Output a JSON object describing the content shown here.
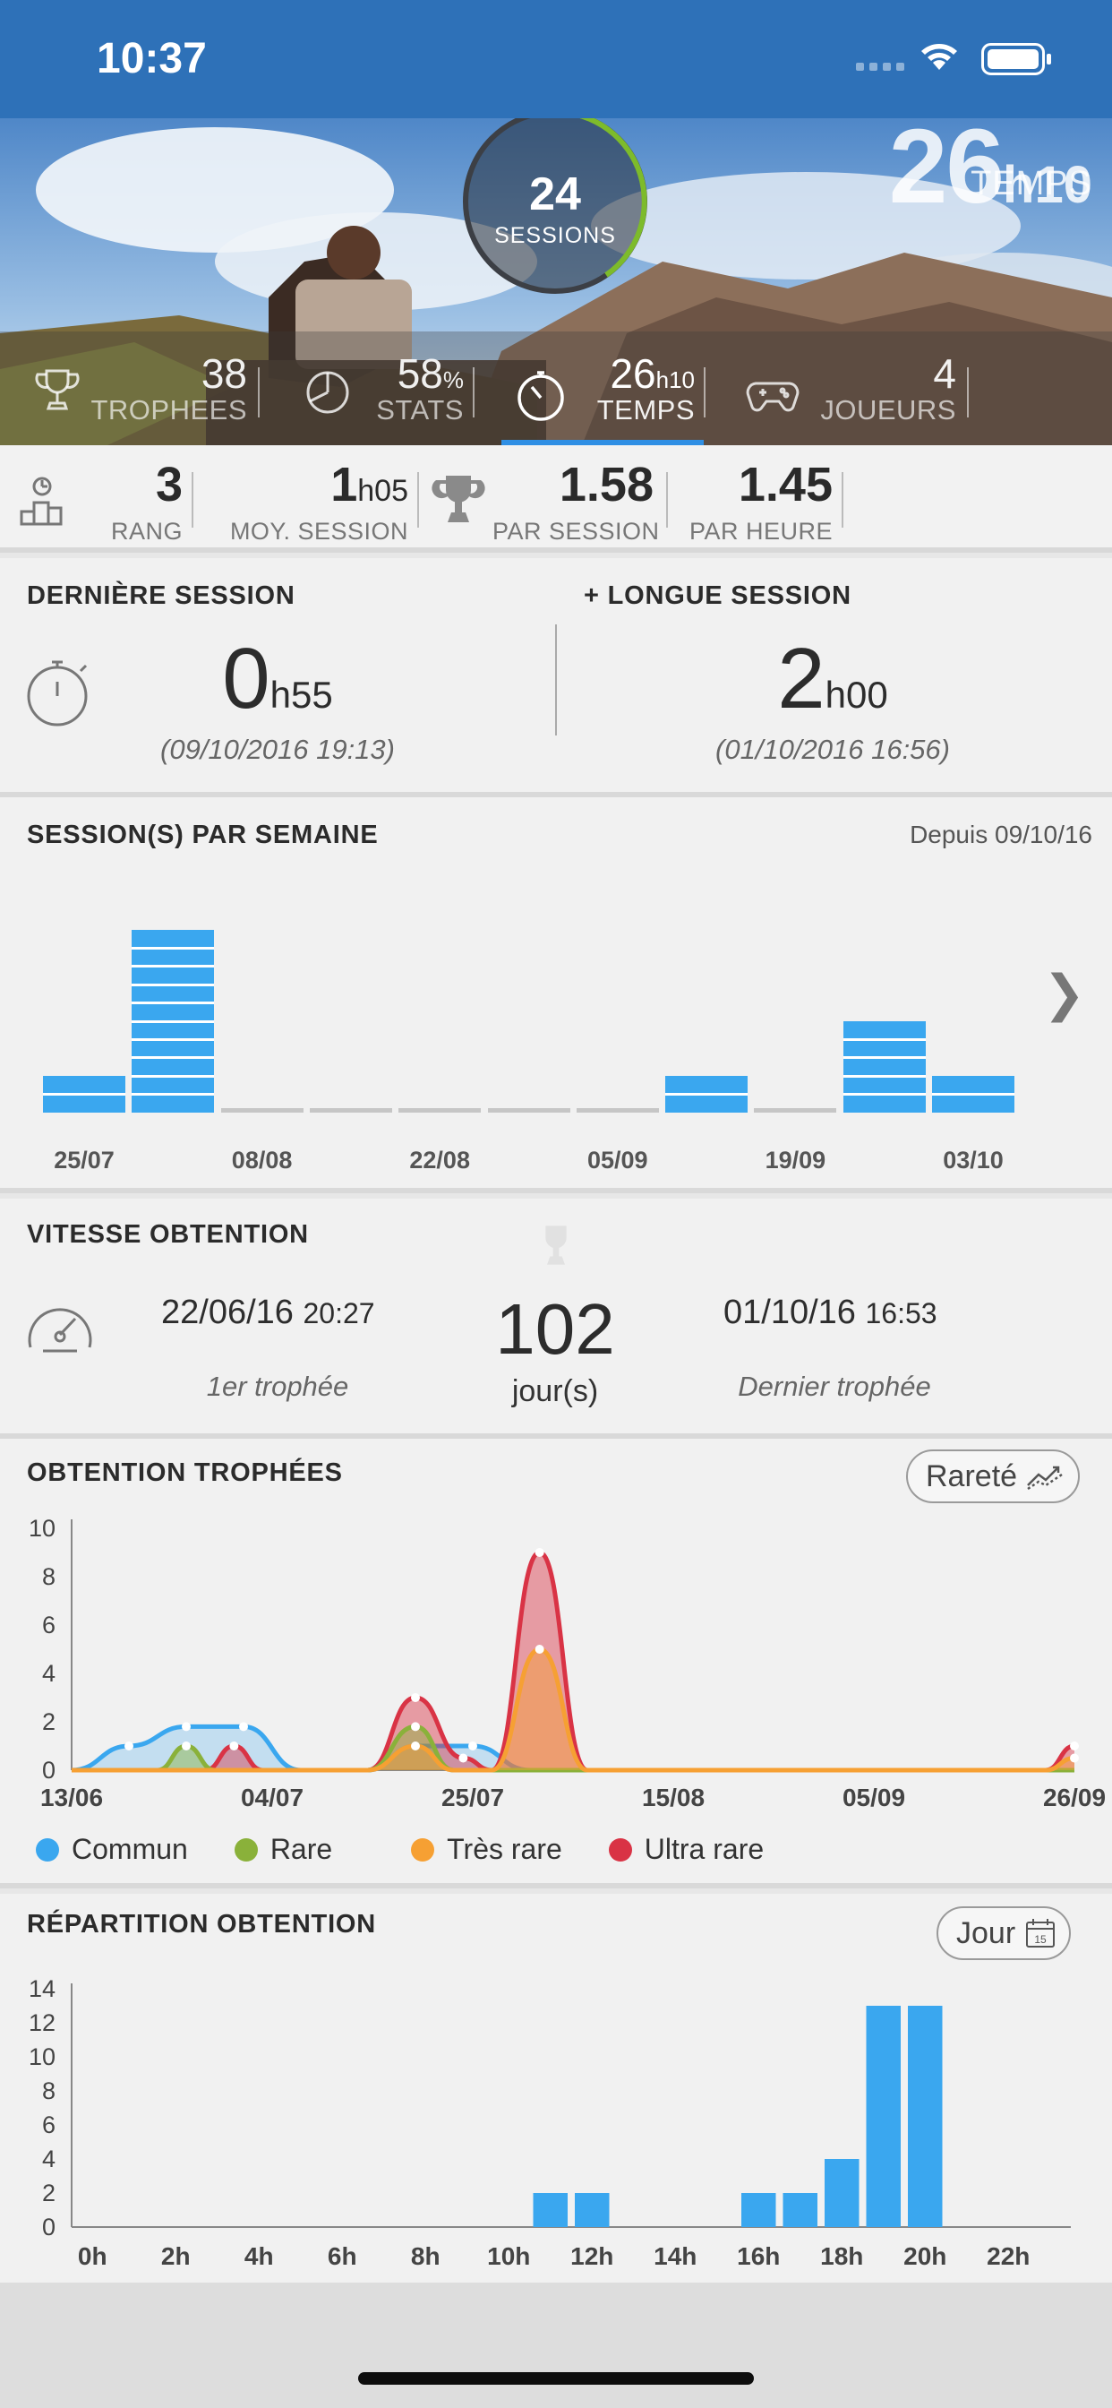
{
  "status_bar": {
    "time": "10:37"
  },
  "hero": {
    "sessions": {
      "value": "24",
      "label": "SESSIONS"
    },
    "big_time": {
      "value": "26",
      "unit": "h10",
      "label": "TEMPS"
    },
    "stats": [
      {
        "value": "38",
        "unit": "",
        "label": "TROPHEES",
        "icon": "trophy-outline-icon"
      },
      {
        "value": "58",
        "unit": "%",
        "label": "STATS",
        "icon": "pie-chart-icon"
      },
      {
        "value": "26",
        "unit": "h10",
        "label": "TEMPS",
        "icon": "stopwatch-icon"
      },
      {
        "value": "4",
        "unit": "",
        "label": "JOUEURS",
        "icon": "gamepad-icon"
      }
    ]
  },
  "rank_row": {
    "icon": "podium-icon",
    "items": [
      {
        "value": "3",
        "unit": "",
        "label": "RANG"
      },
      {
        "value": "1",
        "unit": "h05",
        "label": "MOY. SESSION"
      },
      {
        "value": "1.58",
        "unit": "",
        "label": "PAR SESSION"
      },
      {
        "value": "1.45",
        "unit": "",
        "label": "PAR HEURE"
      }
    ]
  },
  "sessions_card": {
    "last_title": "DERNIÈRE SESSION",
    "last_value": "0",
    "last_unit": "h55",
    "last_date": "(09/10/2016 19:13)",
    "long_title": "+ LONGUE SESSION",
    "long_value": "2",
    "long_unit": "h00",
    "long_date": "(01/10/2016 16:56)"
  },
  "weekly": {
    "title": "SESSION(S) PAR SEMAINE",
    "since": "Depuis 09/10/16",
    "labels": [
      "25/07",
      "08/08",
      "22/08",
      "05/09",
      "19/09",
      "03/10"
    ]
  },
  "speed": {
    "title": "VITESSE OBTENTION",
    "first_date": "22/06/16",
    "first_time": "20:27",
    "first_label": "1er trophée",
    "days": "102",
    "days_unit": "jour(s)",
    "last_date": "01/10/16",
    "last_time": "16:53",
    "last_label": "Dernier trophée"
  },
  "trophies_chart": {
    "title": "OBTENTION TROPHÉES",
    "button": "Rareté"
  },
  "repartition_chart": {
    "title": "RÉPARTITION OBTENTION",
    "button": "Jour",
    "calendar_day": "15"
  },
  "chart_data": [
    {
      "type": "bar",
      "title": "SESSION(S) PAR SEMAINE",
      "categories": [
        "25/07",
        "01/08",
        "08/08",
        "15/08",
        "22/08",
        "29/08",
        "05/09",
        "12/09",
        "19/09",
        "26/09",
        "03/10"
      ],
      "values": [
        2,
        10,
        0,
        0,
        0,
        0,
        0,
        2,
        0,
        5,
        2
      ],
      "tick_labels": [
        "25/07",
        "08/08",
        "22/08",
        "05/09",
        "19/09",
        "03/10"
      ]
    },
    {
      "type": "area",
      "title": "OBTENTION TROPHÉES",
      "x_tick_labels": [
        "13/06",
        "04/07",
        "25/07",
        "15/08",
        "05/09",
        "26/09"
      ],
      "x_tick_days": [
        0,
        21,
        42,
        63,
        84,
        105
      ],
      "ylim": [
        0,
        10
      ],
      "y_ticks": [
        0,
        2,
        4,
        6,
        8,
        10
      ],
      "series": [
        {
          "name": "Commun",
          "color": "#3aa7ef",
          "points": [
            [
              0,
              0
            ],
            [
              6,
              1
            ],
            [
              12,
              1.8
            ],
            [
              18,
              1.8
            ],
            [
              24,
              0
            ],
            [
              31,
              0
            ],
            [
              36,
              1
            ],
            [
              42,
              1
            ],
            [
              48,
              0
            ],
            [
              54,
              0
            ],
            [
              105,
              0
            ]
          ]
        },
        {
          "name": "Rare",
          "color": "#8ab13a",
          "points": [
            [
              0,
              0
            ],
            [
              9,
              0
            ],
            [
              12,
              1
            ],
            [
              15,
              0
            ],
            [
              24,
              0
            ],
            [
              31,
              0
            ],
            [
              36,
              1.8
            ],
            [
              40,
              0
            ],
            [
              46,
              0
            ],
            [
              105,
              0
            ]
          ]
        },
        {
          "name": "Très rare",
          "color": "#f6a033",
          "points": [
            [
              0,
              0
            ],
            [
              31,
              0
            ],
            [
              36,
              1
            ],
            [
              40,
              0
            ],
            [
              44,
              0
            ],
            [
              49,
              5
            ],
            [
              54,
              0
            ],
            [
              102,
              0
            ],
            [
              105,
              0.5
            ]
          ]
        },
        {
          "name": "Ultra rare",
          "color": "#d93345",
          "points": [
            [
              0,
              0
            ],
            [
              14,
              0
            ],
            [
              17,
              1
            ],
            [
              20,
              0
            ],
            [
              31,
              0
            ],
            [
              36,
              3
            ],
            [
              41,
              0.5
            ],
            [
              44,
              0
            ],
            [
              49,
              9
            ],
            [
              54,
              0
            ],
            [
              102,
              0
            ],
            [
              105,
              1
            ]
          ]
        }
      ]
    },
    {
      "type": "bar",
      "title": "RÉPARTITION OBTENTION",
      "categories": [
        "0h",
        "1h",
        "2h",
        "3h",
        "4h",
        "5h",
        "6h",
        "7h",
        "8h",
        "9h",
        "10h",
        "11h",
        "12h",
        "13h",
        "14h",
        "15h",
        "16h",
        "17h",
        "18h",
        "19h",
        "20h",
        "21h",
        "22h",
        "23h"
      ],
      "values": [
        0,
        0,
        0,
        0,
        0,
        0,
        0,
        0,
        0,
        0,
        0,
        2,
        2,
        0,
        0,
        0,
        2,
        2,
        4,
        13,
        13,
        0,
        0,
        0
      ],
      "tick_labels": [
        "0h",
        "2h",
        "4h",
        "6h",
        "8h",
        "10h",
        "12h",
        "14h",
        "16h",
        "18h",
        "20h",
        "22h"
      ],
      "ylim": [
        0,
        14
      ],
      "y_ticks": [
        0,
        2,
        4,
        6,
        8,
        10,
        12,
        14
      ],
      "color": "#3aa7ef"
    }
  ]
}
